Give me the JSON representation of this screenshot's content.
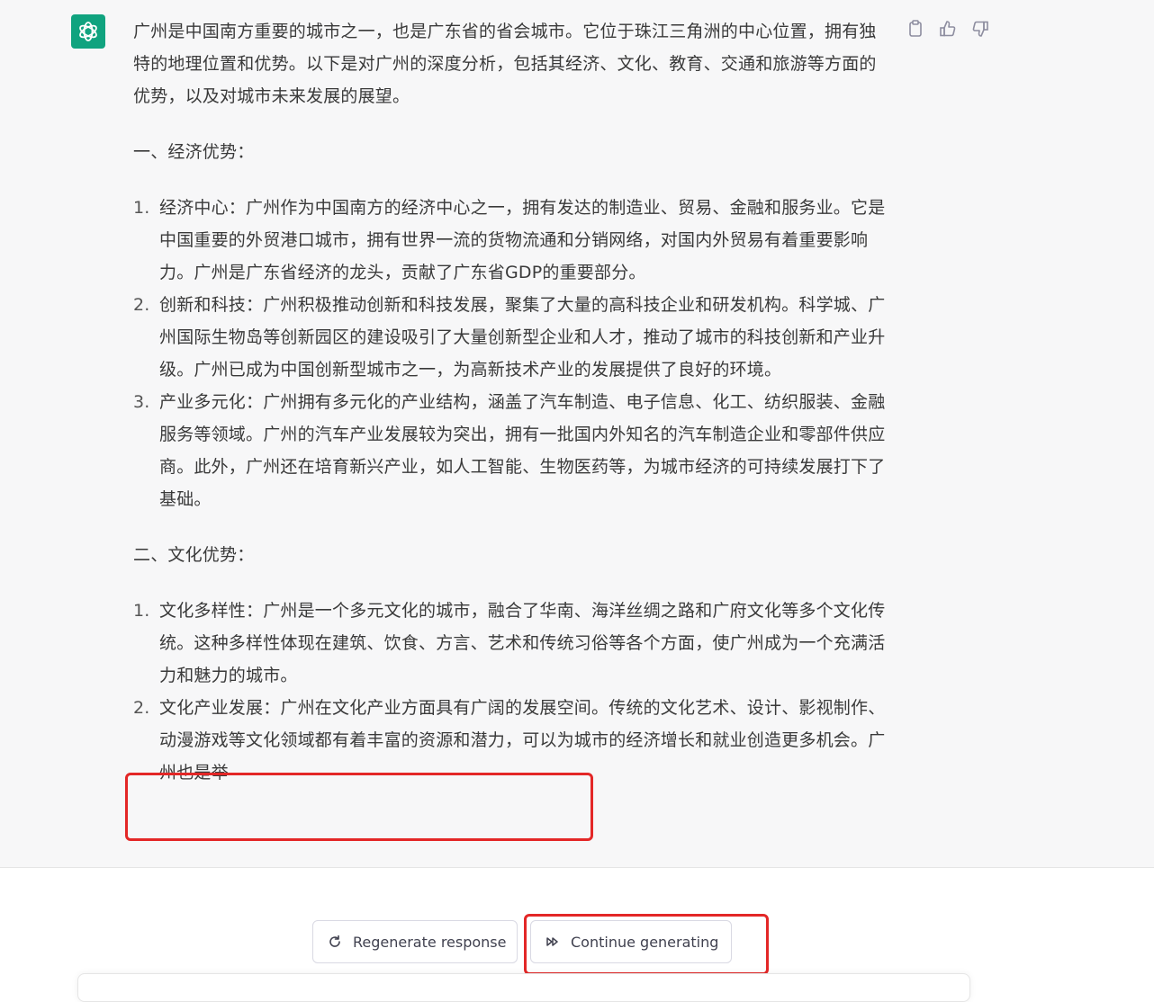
{
  "message": {
    "intro": "广州是中国南方重要的城市之一，也是广东省的省会城市。它位于珠江三角洲的中心位置，拥有独特的地理位置和优势。以下是对广州的深度分析，包括其经济、文化、教育、交通和旅游等方面的优势，以及对城市未来发展的展望。",
    "sections": [
      {
        "heading": "一、经济优势：",
        "items": [
          {
            "num": "1.",
            "text": "经济中心：广州作为中国南方的经济中心之一，拥有发达的制造业、贸易、金融和服务业。它是中国重要的外贸港口城市，拥有世界一流的货物流通和分销网络，对国内外贸易有着重要影响力。广州是广东省经济的龙头，贡献了广东省GDP的重要部分。"
          },
          {
            "num": "2.",
            "text": "创新和科技：广州积极推动创新和科技发展，聚集了大量的高科技企业和研发机构。科学城、广州国际生物岛等创新园区的建设吸引了大量创新型企业和人才，推动了城市的科技创新和产业升级。广州已成为中国创新型城市之一，为高新技术产业的发展提供了良好的环境。"
          },
          {
            "num": "3.",
            "text": "产业多元化：广州拥有多元化的产业结构，涵盖了汽车制造、电子信息、化工、纺织服装、金融服务等领域。广州的汽车产业发展较为突出，拥有一批国内外知名的汽车制造企业和零部件供应商。此外，广州还在培育新兴产业，如人工智能、生物医药等，为城市经济的可持续发展打下了基础。"
          }
        ]
      },
      {
        "heading": "二、文化优势：",
        "items": [
          {
            "num": "1.",
            "text": "文化多样性：广州是一个多元文化的城市，融合了华南、海洋丝绸之路和广府文化等多个文化传统。这种多样性体现在建筑、饮食、方言、艺术和传统习俗等各个方面，使广州成为一个充满活力和魅力的城市。"
          },
          {
            "num": "2.",
            "text": "文化产业发展：广州在文化产业方面具有广阔的发展空间。传统的文化艺术、设计、影视制作、动漫游戏等文化领域都有着丰富的资源和潜力，可以为城市的经济增长和就业创造更多机会。广州也是举"
          }
        ]
      }
    ]
  },
  "actions": {
    "copy_icon": "clipboard-icon",
    "like_icon": "thumbs-up-icon",
    "dislike_icon": "thumbs-down-icon"
  },
  "buttons": {
    "regenerate_label": "Regenerate response",
    "continue_label": "Continue generating"
  },
  "colors": {
    "avatar_bg": "#10a37f",
    "highlight": "#e32727",
    "message_bg": "#f7f7f8"
  }
}
